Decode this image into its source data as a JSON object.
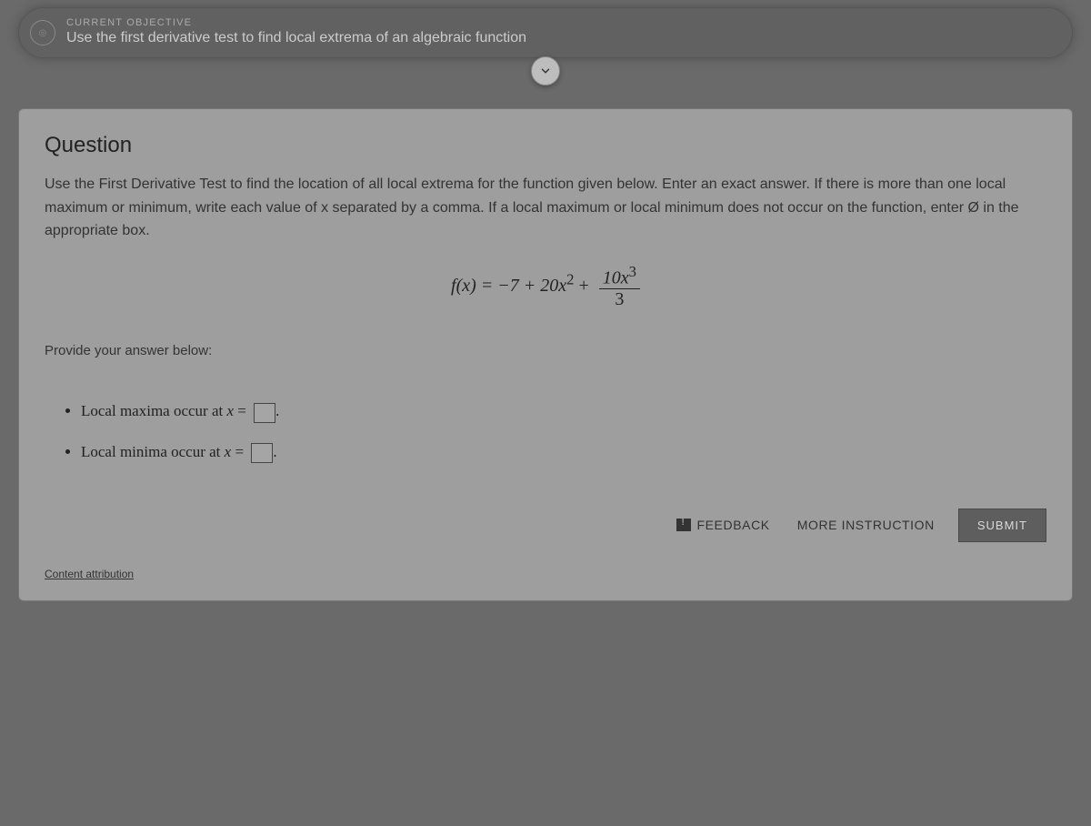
{
  "objective": {
    "label": "CURRENT OBJECTIVE",
    "text": "Use the first derivative test to find local extrema of an algebraic function"
  },
  "question": {
    "heading": "Question",
    "prompt": "Use the First Derivative Test to find the location of all local extrema for the function given below. Enter an exact answer. If there is more than one local maximum or minimum, write each value of x separated by a comma. If a local maximum or local minimum does not occur on the function, enter Ø in the appropriate box.",
    "formula": {
      "lhs": "f(x) = −7 + 20x",
      "squared_exp": "2",
      "plus": " + ",
      "frac_num_coeff": "10x",
      "frac_num_exp": "3",
      "frac_den": "3"
    },
    "provide_label": "Provide your answer below:",
    "answers": {
      "maxima_label": "Local maxima occur at ",
      "minima_label": "Local minima occur at ",
      "var_label": "x",
      "equals": " = ",
      "maxima_value": "",
      "minima_value": ""
    }
  },
  "actions": {
    "feedback": "FEEDBACK",
    "more_instruction": "MORE INSTRUCTION",
    "submit": "SUBMIT"
  },
  "footer": {
    "attribution": "Content attribution"
  }
}
